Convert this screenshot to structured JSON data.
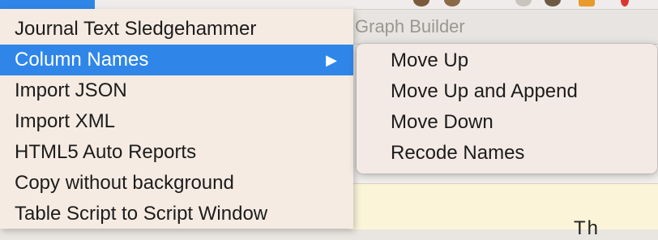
{
  "background_window": {
    "title": "Graph Builder",
    "bottom_text": "Th"
  },
  "main_menu": {
    "items": [
      {
        "label": "Journal Text Sledgehammer",
        "highlighted": false,
        "has_submenu": false
      },
      {
        "label": "Column Names",
        "highlighted": true,
        "has_submenu": true
      },
      {
        "label": "Import JSON",
        "highlighted": false,
        "has_submenu": false
      },
      {
        "label": "Import XML",
        "highlighted": false,
        "has_submenu": false
      },
      {
        "label": "HTML5 Auto Reports",
        "highlighted": false,
        "has_submenu": false
      },
      {
        "label": "Copy without background",
        "highlighted": false,
        "has_submenu": false
      },
      {
        "label": "Table Script to Script Window",
        "highlighted": false,
        "has_submenu": false
      }
    ],
    "submenu_arrow": "▶"
  },
  "submenu": {
    "items": [
      {
        "label": "Move Up"
      },
      {
        "label": "Move Up and Append"
      },
      {
        "label": "Move Down"
      },
      {
        "label": "Recode Names"
      }
    ]
  },
  "colors": {
    "highlight": "#2f86e8",
    "menu_background": "#f5ebe2"
  }
}
